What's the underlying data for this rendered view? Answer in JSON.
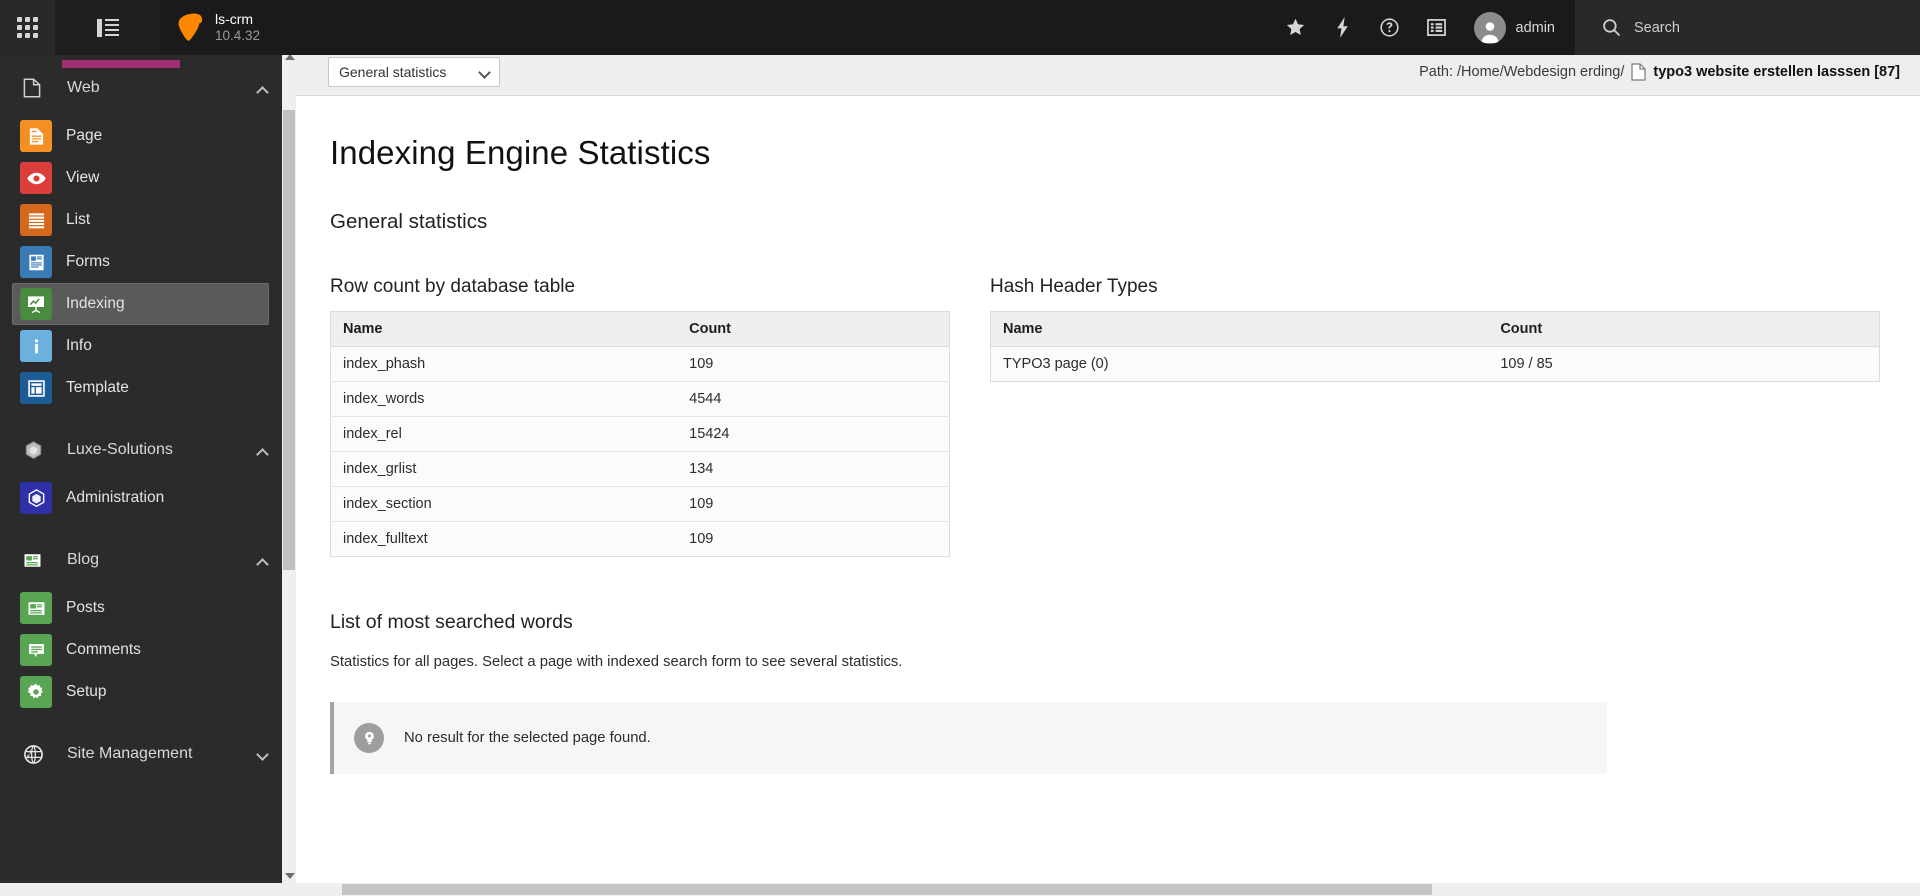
{
  "topbar": {
    "module_menu_icon": "grid-apps-icon",
    "page_tree_icon": "list-tree-icon",
    "logo_icon": "typo3-logo-icon",
    "site_name": "ls-crm",
    "version": "10.4.32",
    "actions": [
      {
        "name": "bookmarks",
        "icon": "star-icon"
      },
      {
        "name": "clear-cache",
        "icon": "bolt-icon"
      },
      {
        "name": "help",
        "icon": "question-circle-icon"
      },
      {
        "name": "system-information",
        "icon": "list-panel-icon"
      }
    ],
    "user": {
      "label": "admin",
      "avatar_icon": "user-avatar-icon"
    },
    "search": {
      "label": "Search",
      "placeholder": "Search",
      "icon": "search-icon"
    }
  },
  "sidebar": {
    "groups": [
      {
        "label": "Web",
        "icon": "page-document-icon",
        "expanded": true,
        "chevron": "chevron-up-icon",
        "items": [
          {
            "label": "Page",
            "icon": "page-icon",
            "color": "#f49023",
            "active": false
          },
          {
            "label": "View",
            "icon": "eye-icon",
            "color": "#dc3d3b",
            "active": false
          },
          {
            "label": "List",
            "icon": "list-icon",
            "color": "#d4691e",
            "active": false
          },
          {
            "label": "Forms",
            "icon": "forms-icon",
            "color": "#3a7ab5",
            "active": false
          },
          {
            "label": "Indexing",
            "icon": "chart-board-icon",
            "color": "#4a8c3f",
            "active": true
          },
          {
            "label": "Info",
            "icon": "info-icon",
            "color": "#6cb0e0",
            "active": false
          },
          {
            "label": "Template",
            "icon": "template-icon",
            "color": "#1d5c96",
            "active": false
          }
        ]
      },
      {
        "label": "Luxe-Solutions",
        "icon": "hexagon-gray-icon",
        "expanded": true,
        "chevron": "chevron-up-icon",
        "items": [
          {
            "label": "Administration",
            "icon": "hexagon-cube-icon",
            "color": "#2e31a8",
            "active": false
          }
        ]
      },
      {
        "label": "Blog",
        "icon": "newspaper-icon",
        "expanded": true,
        "chevron": "chevron-up-icon",
        "items": [
          {
            "label": "Posts",
            "icon": "newspaper-icon",
            "color": "#5aa554",
            "active": false
          },
          {
            "label": "Comments",
            "icon": "comment-icon",
            "color": "#5aa554",
            "active": false
          },
          {
            "label": "Setup",
            "icon": "gear-icon",
            "color": "#5aa554",
            "active": false
          }
        ]
      },
      {
        "label": "Site Management",
        "icon": "globe-icon",
        "expanded": false,
        "chevron": "chevron-down-icon",
        "items": []
      }
    ]
  },
  "module_header": {
    "statistics_select": {
      "selected": "General statistics",
      "options": [
        "General statistics"
      ],
      "caret_icon": "chevron-down-icon"
    },
    "path_prefix": "Path: /Home/Webdesign erding/",
    "path_page_icon": "page-document-icon",
    "path_page_title": "typo3 website erstellen lasssen [87]"
  },
  "content": {
    "page_title": "Indexing Engine Statistics",
    "section_title": "General statistics",
    "row_count_table": {
      "title": "Row count by database table",
      "headers": [
        "Name",
        "Count"
      ],
      "rows": [
        [
          "index_phash",
          "109"
        ],
        [
          "index_words",
          "4544"
        ],
        [
          "index_rel",
          "15424"
        ],
        [
          "index_grlist",
          "134"
        ],
        [
          "index_section",
          "109"
        ],
        [
          "index_fulltext",
          "109"
        ]
      ]
    },
    "hash_header_table": {
      "title": "Hash Header Types",
      "headers": [
        "Name",
        "Count"
      ],
      "rows": [
        [
          "TYPO3 page (0)",
          "109 / 85"
        ]
      ]
    },
    "searched_words": {
      "title": "List of most searched words",
      "description": "Statistics for all pages. Select a page with indexed search form to see several statistics.",
      "infobox": {
        "icon": "lightbulb-icon",
        "message": "No result for the selected page found."
      }
    }
  }
}
